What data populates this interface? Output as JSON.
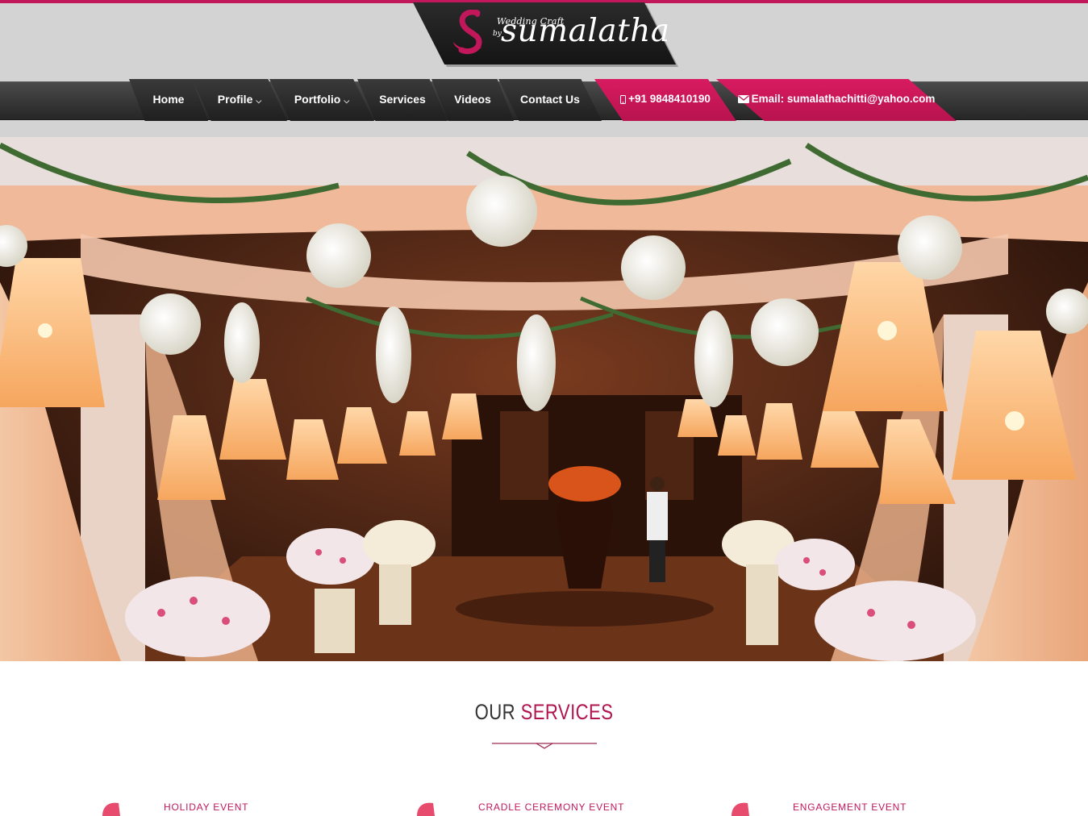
{
  "brand": {
    "tagline": "Wedding Craft",
    "by": "by",
    "name": "sumalatha",
    "accent_color": "#c2185b"
  },
  "nav": {
    "items": [
      {
        "label": "Home",
        "has_dropdown": false
      },
      {
        "label": "Profile",
        "has_dropdown": true
      },
      {
        "label": "Portfolio",
        "has_dropdown": true
      },
      {
        "label": "Services",
        "has_dropdown": false
      },
      {
        "label": "Videos",
        "has_dropdown": false
      },
      {
        "label": "Contact Us",
        "has_dropdown": false
      }
    ],
    "phone": {
      "label": "+91 9848410190",
      "icon": "mobile-icon"
    },
    "email": {
      "label": "Email: sumalathachitti@yahoo.com",
      "icon": "envelope-icon"
    }
  },
  "hero": {
    "description": "Wedding venue decor with hanging lamps and white flower balls"
  },
  "services": {
    "title_part1": "OUR",
    "title_part2": "SERVICES",
    "items": [
      {
        "label": "HOLIDAY EVENT"
      },
      {
        "label": "CRADLE CEREMONY EVENT"
      },
      {
        "label": "ENGAGEMENT EVENT"
      }
    ]
  }
}
